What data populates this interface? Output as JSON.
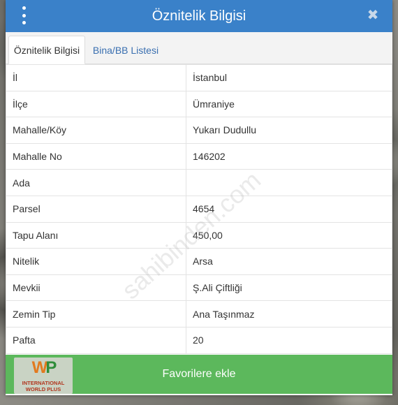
{
  "header": {
    "title": "Öznitelik Bilgisi",
    "menu_icon": "kebab-menu-icon",
    "close_icon": "close-icon",
    "close_glyph": "✖"
  },
  "tabs": [
    {
      "label": "Öznitelik Bilgisi",
      "active": true
    },
    {
      "label": "Bina/BB Listesi",
      "active": false
    }
  ],
  "attributes": [
    {
      "label": "İl",
      "value": "İstanbul"
    },
    {
      "label": "İlçe",
      "value": "Ümraniye"
    },
    {
      "label": "Mahalle/Köy",
      "value": "Yukarı Dudullu"
    },
    {
      "label": "Mahalle No",
      "value": "146202"
    },
    {
      "label": "Ada",
      "value": ""
    },
    {
      "label": "Parsel",
      "value": "4654"
    },
    {
      "label": "Tapu Alanı",
      "value": "450,00"
    },
    {
      "label": "Nitelik",
      "value": "Arsa"
    },
    {
      "label": "Mevkii",
      "value": "Ş.Ali Çiftliği"
    },
    {
      "label": "Zemin Tip",
      "value": "Ana Taşınmaz"
    },
    {
      "label": "Pafta",
      "value": "20"
    }
  ],
  "watermark": "sahibinden.com",
  "footer": {
    "favorite_label": "Favorilere ekle",
    "logo_mark_w": "W",
    "logo_mark_p": "P",
    "logo_line1": "INTERNATIONAL",
    "logo_line2": "WORLD PLUS"
  },
  "colors": {
    "header_bg": "#3a81c9",
    "tab_link": "#3a6fb0",
    "button_bg": "#5cb85c"
  }
}
